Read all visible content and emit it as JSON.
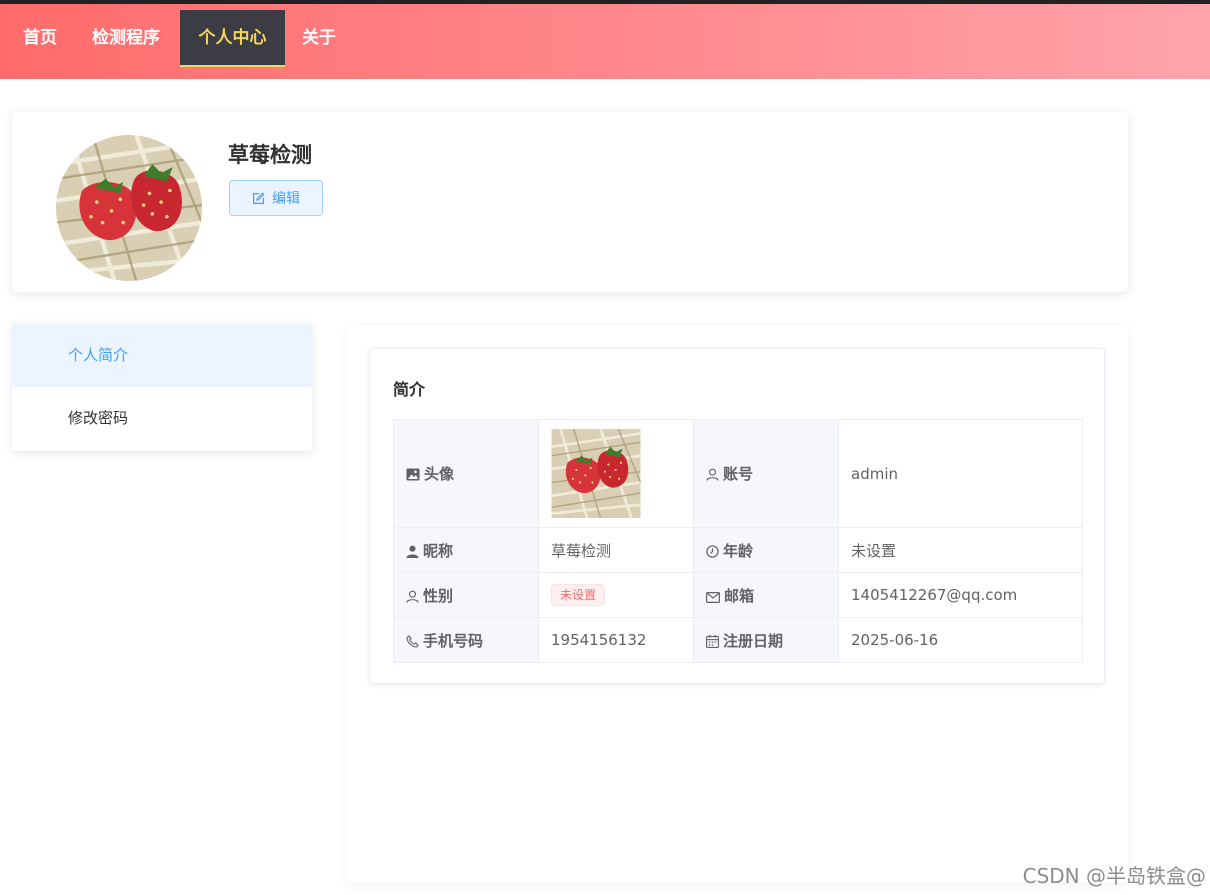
{
  "nav": {
    "items": [
      {
        "label": "首页"
      },
      {
        "label": "检测程序"
      },
      {
        "label": "个人中心",
        "active": true
      },
      {
        "label": "关于"
      }
    ]
  },
  "profile": {
    "name": "草莓检测",
    "edit_label": "编辑"
  },
  "side_menu": {
    "items": [
      {
        "label": "个人简介",
        "active": true
      },
      {
        "label": "修改密码"
      }
    ]
  },
  "intro": {
    "title": "简介",
    "avatar_label": "头像",
    "account_label": "账号",
    "account_value": "admin",
    "nickname_label": "昵称",
    "nickname_value": "草莓检测",
    "age_label": "年龄",
    "age_value": "未设置",
    "gender_label": "性别",
    "gender_value": "未设置",
    "email_label": "邮箱",
    "email_value": "1405412267@qq.com",
    "phone_label": "手机号码",
    "phone_value": "1954156132",
    "register_label": "注册日期",
    "register_value": "2025-06-16"
  },
  "watermark": "CSDN @半岛铁盒@",
  "colors": {
    "nav_gradient_start": "#ff6b6b",
    "nav_gradient_end": "#ffa4ab",
    "nav_active_bg": "#3c3d44",
    "nav_active_text": "#f3d65a",
    "primary": "#409eff",
    "danger": "#f56c6c"
  }
}
